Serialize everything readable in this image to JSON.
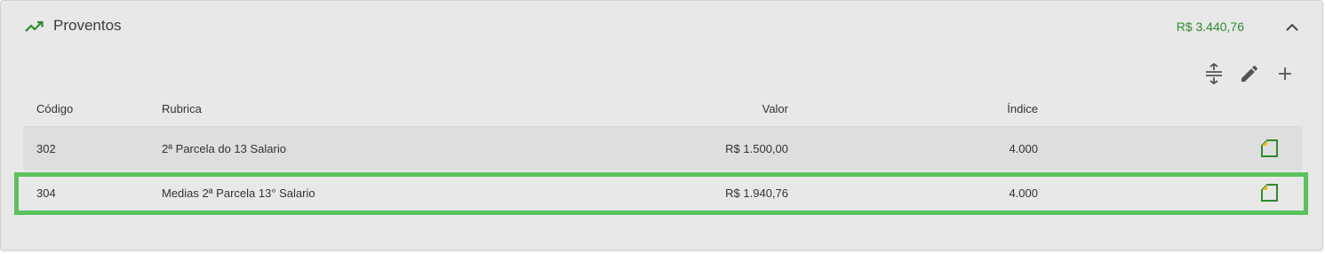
{
  "panel": {
    "title": "Proventos",
    "total": "R$ 3.440,76",
    "icons": {
      "header": "trending-up-icon",
      "collapse": "chevron-up-icon",
      "expand": "expand-vertical-icon",
      "edit": "pencil-icon",
      "add": "plus-icon",
      "row_action": "copy-document-icon"
    },
    "colors": {
      "accent": "#2e8b2e",
      "highlight": "#5cc35c",
      "row_alt": "#dfdede"
    }
  },
  "table": {
    "columns": {
      "codigo": "Código",
      "rubrica": "Rubrica",
      "valor": "Valor",
      "indice": "Índice"
    },
    "rows": [
      {
        "codigo": "302",
        "rubrica": "2ª Parcela do 13 Salario",
        "valor": "R$ 1.500,00",
        "indice": "4.000"
      },
      {
        "codigo": "304",
        "rubrica": "Medias 2ª Parcela 13° Salario",
        "valor": "R$ 1.940,76",
        "indice": "4.000"
      }
    ]
  }
}
